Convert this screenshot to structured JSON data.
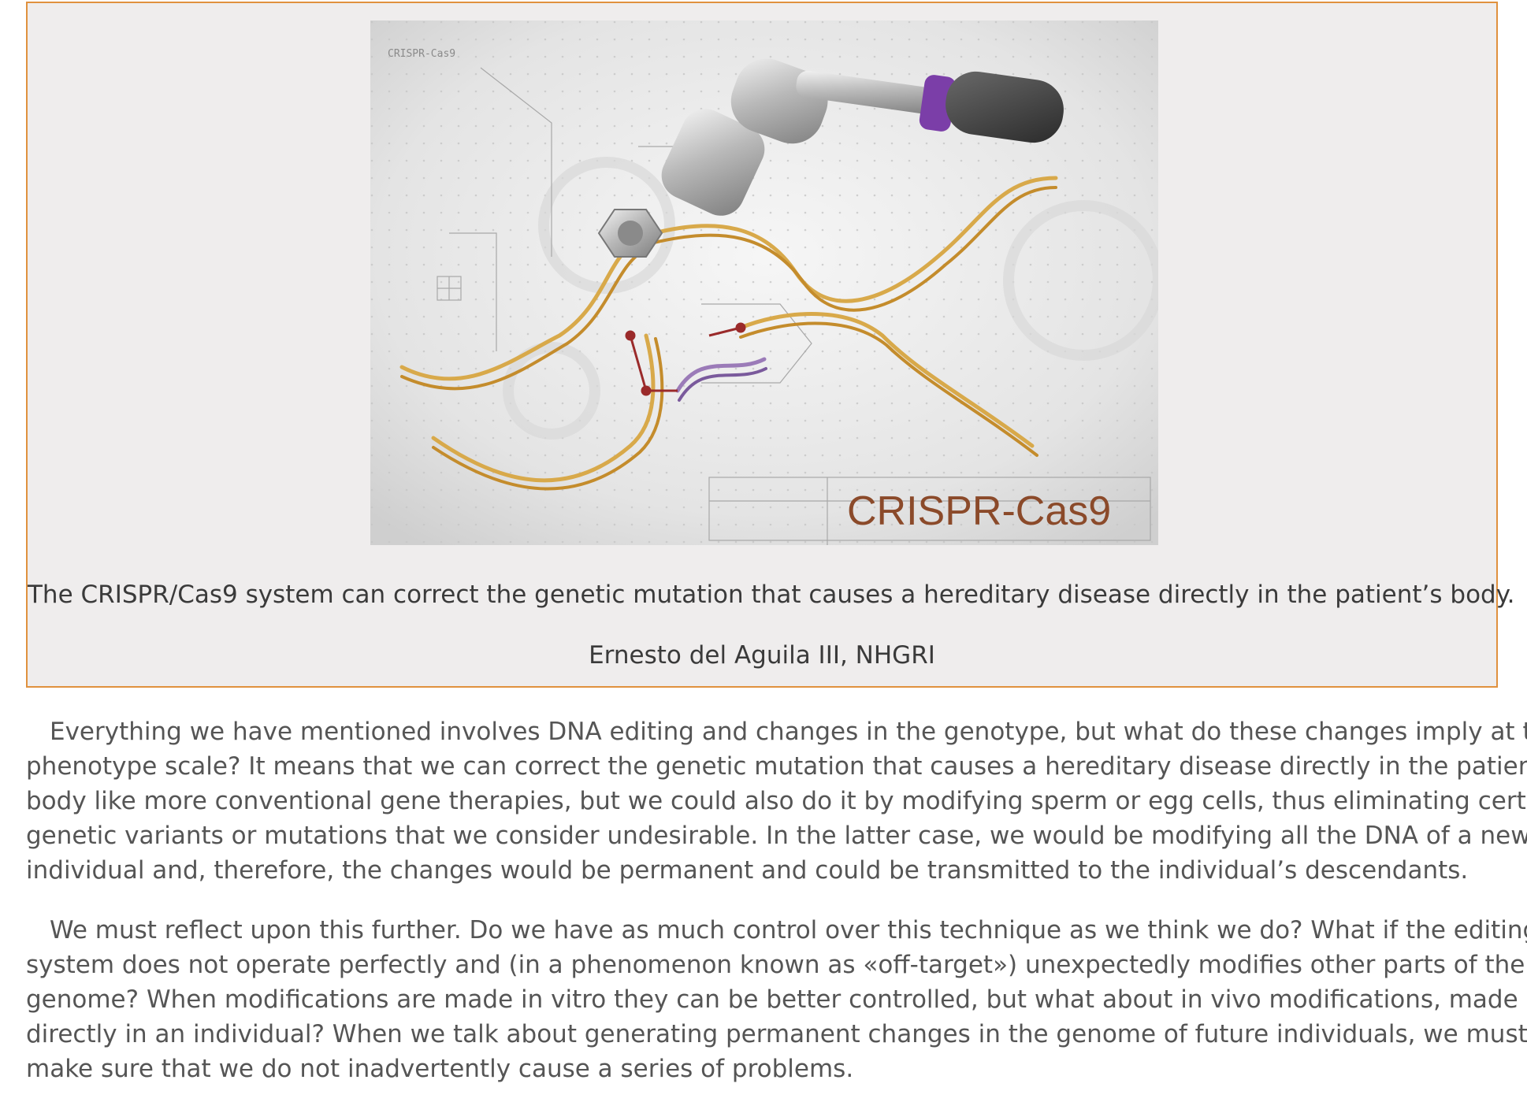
{
  "figure": {
    "image_alt": "CRISPR-Cas9 illustration: a ratchet wrench turning a nut on a DNA double helix over a technical blueprint background with gears",
    "image_title_text": "CRISPR-Cas9",
    "image_corner_label": "CRISPR-Cas9",
    "caption": "The CRISPR/Cas9 system can correct the genetic mutation that causes a hereditary disease directly in the patient’s body.",
    "credit": "Ernesto del Aguila III, NHGRI",
    "border_color": "#e0913e",
    "background_color": "#efeded"
  },
  "article": {
    "paragraphs": [
      {
        "lines": [
          "Everything we have mentioned involves DNA editing and changes in the genotype, but what do these changes imply at the",
          "phenotype scale? It means that we can correct the genetic mutation that causes a hereditary disease directly in the patient’s",
          "body like more conventional gene therapies, but we could also do it by modifying sperm or egg cells, thus eliminating certain",
          "genetic variants or mutations that we consider undesirable. In the latter case, we would be modifying all the DNA of a new",
          "individual and, therefore, the changes would be permanent and could be transmitted to the individual’s descendants."
        ]
      },
      {
        "lines": [
          "We must reflect upon this further. Do we have as much control over this technique as we think we do? What if the editing",
          "system does not operate perfectly and (in a phenomenon known as «off-target») unexpectedly modifies other parts of the",
          "genome? When modifications are made in vitro they can be better controlled, but what about in vivo modifications, made",
          "directly in an individual? When we talk about generating permanent changes in the genome of future individuals, we must",
          "make sure that we do not inadvertently cause a series of problems."
        ]
      }
    ]
  }
}
